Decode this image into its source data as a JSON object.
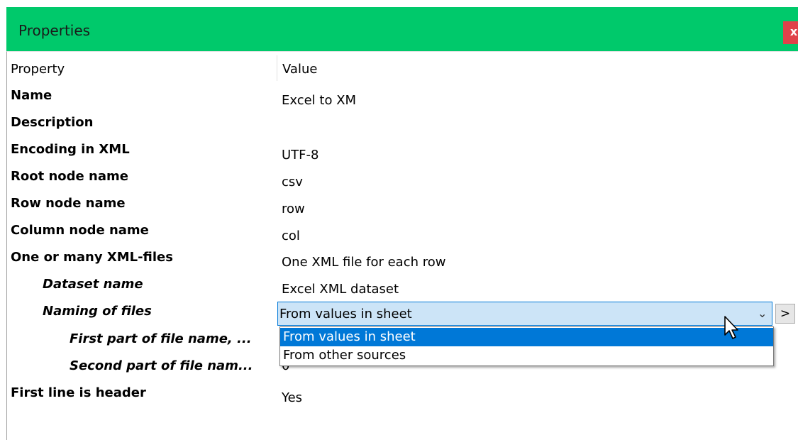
{
  "window": {
    "title": "Properties",
    "close_label": "x"
  },
  "table": {
    "header_property": "Property",
    "header_value": "Value",
    "rows": [
      {
        "label": "Name",
        "value": "Excel to XM"
      },
      {
        "label": "Description",
        "value": ""
      },
      {
        "label": "Encoding in XML",
        "value": "UTF-8"
      },
      {
        "label": "Root node name",
        "value": "csv"
      },
      {
        "label": "Row node name",
        "value": "row"
      },
      {
        "label": "Column node name",
        "value": "col"
      },
      {
        "label": "One or many XML-files",
        "value": "One XML file for each row"
      },
      {
        "label": "Dataset name",
        "value": "Excel XML dataset"
      },
      {
        "label": "Naming of files",
        "value": "From values in sheet"
      },
      {
        "label": "First part of file name, ...",
        "value": ""
      },
      {
        "label": "Second part of file nam...",
        "value": "0"
      },
      {
        "label": "First line is header",
        "value": "Yes"
      }
    ]
  },
  "dropdown": {
    "selected": "From values in sheet",
    "more_label": ">",
    "options": [
      "From values in sheet",
      "From other sources"
    ]
  },
  "colors": {
    "titlebar": "#00c96b",
    "close": "#e0424a",
    "selection": "#0078d7",
    "combo": "#cce4f7"
  }
}
